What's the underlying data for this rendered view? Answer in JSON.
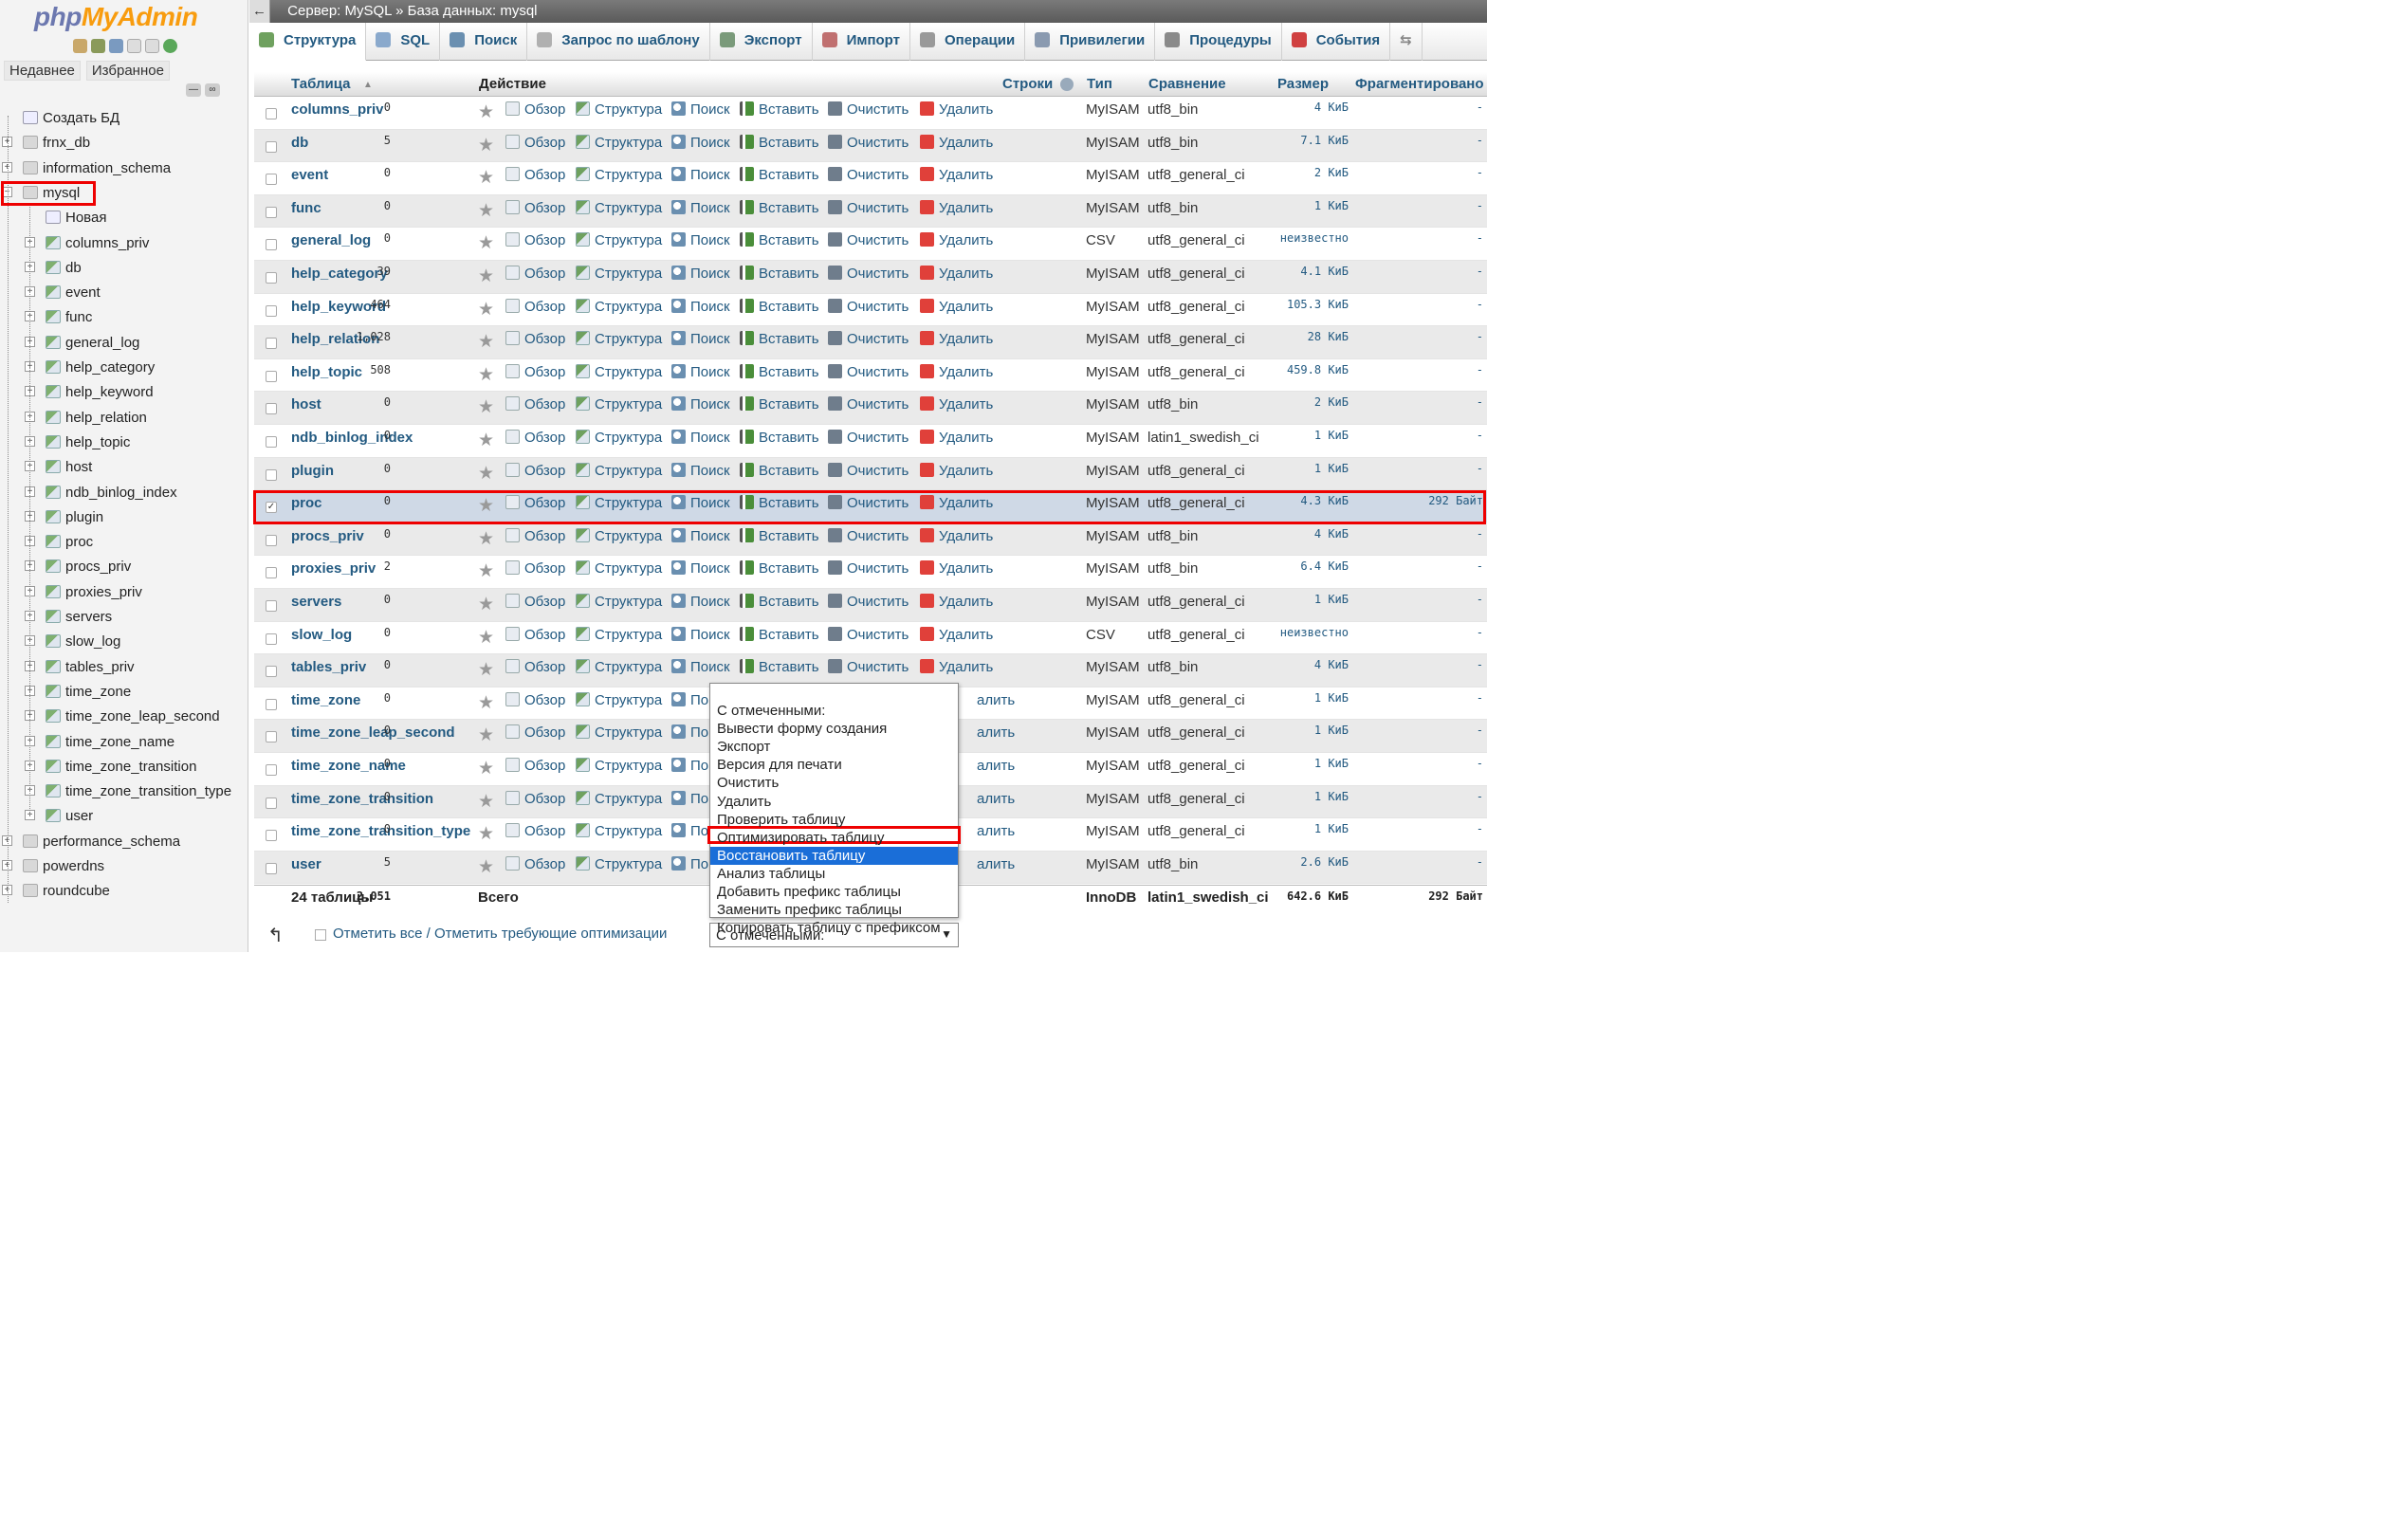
{
  "sidebar": {
    "logo_a": "php",
    "logo_b": "MyAdmin",
    "recent_tab": "Недавнее",
    "favorites_tab": "Избранное",
    "items": [
      {
        "label": "Создать БД",
        "level": 0,
        "kind": "new"
      },
      {
        "label": "frnx_db",
        "level": 0,
        "kind": "db"
      },
      {
        "label": "information_schema",
        "level": 0,
        "kind": "db"
      },
      {
        "label": "mysql",
        "level": 0,
        "kind": "db"
      },
      {
        "label": "Новая",
        "level": 1,
        "kind": "new"
      },
      {
        "label": "columns_priv",
        "level": 1,
        "kind": "tbl"
      },
      {
        "label": "db",
        "level": 1,
        "kind": "tbl"
      },
      {
        "label": "event",
        "level": 1,
        "kind": "tbl"
      },
      {
        "label": "func",
        "level": 1,
        "kind": "tbl"
      },
      {
        "label": "general_log",
        "level": 1,
        "kind": "tbl"
      },
      {
        "label": "help_category",
        "level": 1,
        "kind": "tbl"
      },
      {
        "label": "help_keyword",
        "level": 1,
        "kind": "tbl"
      },
      {
        "label": "help_relation",
        "level": 1,
        "kind": "tbl"
      },
      {
        "label": "help_topic",
        "level": 1,
        "kind": "tbl"
      },
      {
        "label": "host",
        "level": 1,
        "kind": "tbl"
      },
      {
        "label": "ndb_binlog_index",
        "level": 1,
        "kind": "tbl"
      },
      {
        "label": "plugin",
        "level": 1,
        "kind": "tbl"
      },
      {
        "label": "proc",
        "level": 1,
        "kind": "tbl"
      },
      {
        "label": "procs_priv",
        "level": 1,
        "kind": "tbl"
      },
      {
        "label": "proxies_priv",
        "level": 1,
        "kind": "tbl"
      },
      {
        "label": "servers",
        "level": 1,
        "kind": "tbl"
      },
      {
        "label": "slow_log",
        "level": 1,
        "kind": "tbl"
      },
      {
        "label": "tables_priv",
        "level": 1,
        "kind": "tbl"
      },
      {
        "label": "time_zone",
        "level": 1,
        "kind": "tbl"
      },
      {
        "label": "time_zone_leap_second",
        "level": 1,
        "kind": "tbl"
      },
      {
        "label": "time_zone_name",
        "level": 1,
        "kind": "tbl"
      },
      {
        "label": "time_zone_transition",
        "level": 1,
        "kind": "tbl"
      },
      {
        "label": "time_zone_transition_type",
        "level": 1,
        "kind": "tbl"
      },
      {
        "label": "user",
        "level": 1,
        "kind": "tbl"
      },
      {
        "label": "performance_schema",
        "level": 0,
        "kind": "db"
      },
      {
        "label": "powerdns",
        "level": 0,
        "kind": "db"
      },
      {
        "label": "roundcube",
        "level": 0,
        "kind": "db"
      }
    ]
  },
  "breadcrumb": {
    "server": "Сервер: MySQL",
    "sep": "»",
    "database": "База данных: mysql"
  },
  "tabs": [
    {
      "label": "Структура",
      "icon": "structure-icon",
      "color": "#6fa15f",
      "active": true
    },
    {
      "label": "SQL",
      "icon": "sql-icon",
      "color": "#8aa9cc"
    },
    {
      "label": "Поиск",
      "icon": "search-icon",
      "color": "#6a8fb0"
    },
    {
      "label": "Запрос по шаблону",
      "icon": "query-icon",
      "color": "#b0b0b0"
    },
    {
      "label": "Экспорт",
      "icon": "export-icon",
      "color": "#7a9a7a"
    },
    {
      "label": "Импорт",
      "icon": "import-icon",
      "color": "#c07070"
    },
    {
      "label": "Операции",
      "icon": "wrench-icon",
      "color": "#999999"
    },
    {
      "label": "Привилегии",
      "icon": "privileges-icon",
      "color": "#8a9ab0"
    },
    {
      "label": "Процедуры",
      "icon": "routines-icon",
      "color": "#8a8a8a"
    },
    {
      "label": "События",
      "icon": "events-icon",
      "color": "#d04040"
    }
  ],
  "table_header": {
    "table": "Таблица",
    "sort_indicator": "▲",
    "action": "Действие",
    "rows": "Строки",
    "type": "Тип",
    "collation": "Сравнение",
    "size": "Размер",
    "overhead": "Фрагментировано"
  },
  "actions": {
    "browse": "Обзор",
    "structure": "Структура",
    "search": "Поиск",
    "insert": "Вставить",
    "empty": "Очистить",
    "drop": "Удалить",
    "drop_partial": "алить",
    "search_partial": "По"
  },
  "rows": [
    {
      "name": "columns_priv",
      "rows": "0",
      "type": "MyISAM",
      "coll": "utf8_bin",
      "size": "4 КиБ",
      "frag": "-"
    },
    {
      "name": "db",
      "rows": "5",
      "type": "MyISAM",
      "coll": "utf8_bin",
      "size": "7.1 КиБ",
      "frag": "-"
    },
    {
      "name": "event",
      "rows": "0",
      "type": "MyISAM",
      "coll": "utf8_general_ci",
      "size": "2 КиБ",
      "frag": "-"
    },
    {
      "name": "func",
      "rows": "0",
      "type": "MyISAM",
      "coll": "utf8_bin",
      "size": "1 КиБ",
      "frag": "-"
    },
    {
      "name": "general_log",
      "rows": "0",
      "type": "CSV",
      "coll": "utf8_general_ci",
      "size": "неизвестно",
      "frag": "-"
    },
    {
      "name": "help_category",
      "rows": "39",
      "type": "MyISAM",
      "coll": "utf8_general_ci",
      "size": "4.1 КиБ",
      "frag": "-"
    },
    {
      "name": "help_keyword",
      "rows": "464",
      "type": "MyISAM",
      "coll": "utf8_general_ci",
      "size": "105.3 КиБ",
      "frag": "-"
    },
    {
      "name": "help_relation",
      "rows": "1,028",
      "type": "MyISAM",
      "coll": "utf8_general_ci",
      "size": "28 КиБ",
      "frag": "-"
    },
    {
      "name": "help_topic",
      "rows": "508",
      "type": "MyISAM",
      "coll": "utf8_general_ci",
      "size": "459.8 КиБ",
      "frag": "-"
    },
    {
      "name": "host",
      "rows": "0",
      "type": "MyISAM",
      "coll": "utf8_bin",
      "size": "2 КиБ",
      "frag": "-"
    },
    {
      "name": "ndb_binlog_index",
      "rows": "0",
      "type": "MyISAM",
      "coll": "latin1_swedish_ci",
      "size": "1 КиБ",
      "frag": "-"
    },
    {
      "name": "plugin",
      "rows": "0",
      "type": "MyISAM",
      "coll": "utf8_general_ci",
      "size": "1 КиБ",
      "frag": "-"
    },
    {
      "name": "proc",
      "rows": "0",
      "type": "MyISAM",
      "coll": "utf8_general_ci",
      "size": "4.3 КиБ",
      "frag": "292 Байт",
      "checked": true
    },
    {
      "name": "procs_priv",
      "rows": "0",
      "type": "MyISAM",
      "coll": "utf8_bin",
      "size": "4 КиБ",
      "frag": "-"
    },
    {
      "name": "proxies_priv",
      "rows": "2",
      "type": "MyISAM",
      "coll": "utf8_bin",
      "size": "6.4 КиБ",
      "frag": "-"
    },
    {
      "name": "servers",
      "rows": "0",
      "type": "MyISAM",
      "coll": "utf8_general_ci",
      "size": "1 КиБ",
      "frag": "-"
    },
    {
      "name": "slow_log",
      "rows": "0",
      "type": "CSV",
      "coll": "utf8_general_ci",
      "size": "неизвестно",
      "frag": "-"
    },
    {
      "name": "tables_priv",
      "rows": "0",
      "type": "MyISAM",
      "coll": "utf8_bin",
      "size": "4 КиБ",
      "frag": "-"
    },
    {
      "name": "time_zone",
      "rows": "0",
      "type": "MyISAM",
      "coll": "utf8_general_ci",
      "size": "1 КиБ",
      "frag": "-",
      "covered": true
    },
    {
      "name": "time_zone_leap_second",
      "rows": "0",
      "type": "MyISAM",
      "coll": "utf8_general_ci",
      "size": "1 КиБ",
      "frag": "-",
      "covered": true
    },
    {
      "name": "time_zone_name",
      "rows": "0",
      "type": "MyISAM",
      "coll": "utf8_general_ci",
      "size": "1 КиБ",
      "frag": "-",
      "covered": true
    },
    {
      "name": "time_zone_transition",
      "rows": "0",
      "type": "MyISAM",
      "coll": "utf8_general_ci",
      "size": "1 КиБ",
      "frag": "-",
      "covered": true
    },
    {
      "name": "time_zone_transition_type",
      "rows": "0",
      "type": "MyISAM",
      "coll": "utf8_general_ci",
      "size": "1 КиБ",
      "frag": "-",
      "covered": true
    },
    {
      "name": "user",
      "rows": "5",
      "type": "MyISAM",
      "coll": "utf8_bin",
      "size": "2.6 КиБ",
      "frag": "-",
      "covered": true
    }
  ],
  "totals": {
    "count": "24 таблицы",
    "label": "Всего",
    "rows": "2,051",
    "type": "InnoDB",
    "coll": "latin1_swedish_ci",
    "size": "642.6 КиБ",
    "frag": "292 Байт"
  },
  "footer": {
    "check_all": "Отметить все / Отметить требующие оптимизации",
    "select_value": "С отмеченными:"
  },
  "dropdown_options": [
    "С отмеченными:",
    "Вывести форму создания",
    "Экспорт",
    "Версия для печати",
    "Очистить",
    "Удалить",
    "Проверить таблицу",
    "Оптимизировать таблицу",
    "Восстановить таблицу",
    "Анализ таблицы",
    "Добавить префикс таблицы",
    "Заменить префикс таблицы",
    "Копировать таблицу с префиксом"
  ],
  "dropdown_highlight_index": 8,
  "colors": {
    "link": "#235a81",
    "highlight": "#1a6ed8",
    "annotation_red": "#e00000"
  }
}
